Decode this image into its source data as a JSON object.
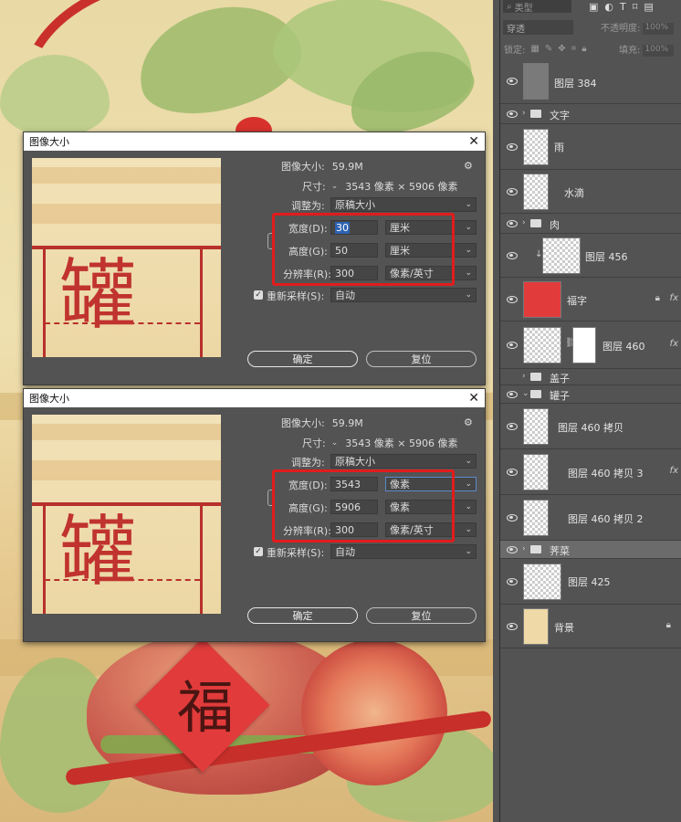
{
  "dialog_title": "图像大小",
  "dialogs": [
    {
      "title": "图像大小",
      "image_size_label": "图像大小:",
      "image_size_value": "59.9M",
      "dimensions_label": "尺寸:",
      "dimensions_value": "3543 像素 × 5906 像素",
      "fit_label": "调整为:",
      "fit_value": "原稿大小",
      "width_label": "宽度(D):",
      "width_value": "30",
      "width_unit": "厘米",
      "height_label": "高度(G):",
      "height_value": "50",
      "height_unit": "厘米",
      "resolution_label": "分辨率(R):",
      "resolution_value": "300",
      "resolution_unit": "像素/英寸",
      "resample_label": "重新采样(S):",
      "resample_value": "自动",
      "ok_label": "确定",
      "reset_label": "复位"
    },
    {
      "title": "图像大小",
      "image_size_label": "图像大小:",
      "image_size_value": "59.9M",
      "dimensions_label": "尺寸:",
      "dimensions_value": "3543 像素 × 5906 像素",
      "fit_label": "调整为:",
      "fit_value": "原稿大小",
      "width_label": "宽度(D):",
      "width_value": "3543",
      "width_unit": "像素",
      "height_label": "高度(G):",
      "height_value": "5906",
      "height_unit": "像素",
      "resolution_label": "分辨率(R):",
      "resolution_value": "300",
      "resolution_unit": "像素/英寸",
      "resample_label": "重新采样(S):",
      "resample_value": "自动",
      "ok_label": "确定",
      "reset_label": "复位"
    }
  ],
  "canvas": {
    "fu_character": "福",
    "preview_characters": "罐"
  },
  "layers_panel": {
    "filter_placeholder": "类型",
    "blend_mode": "穿透",
    "opacity_label": "不透明度:",
    "opacity_value": "100%",
    "lock_label": "锁定:",
    "fill_label": "填充:",
    "fill_value": "100%",
    "layers": [
      {
        "name": "图层 384",
        "kind": "layer"
      },
      {
        "name": "文字",
        "kind": "group"
      },
      {
        "name": "雨",
        "kind": "layer"
      },
      {
        "name": "水滴",
        "kind": "layer"
      },
      {
        "name": "肉",
        "kind": "group"
      },
      {
        "name": "图层 456",
        "kind": "layer"
      },
      {
        "name": "福字",
        "kind": "layer"
      },
      {
        "name": "图层 460",
        "kind": "layer"
      },
      {
        "name": "盖子",
        "kind": "group"
      },
      {
        "name": "罐子",
        "kind": "group"
      },
      {
        "name": "图层 460 拷贝",
        "kind": "layer"
      },
      {
        "name": "图层 460 拷贝 3",
        "kind": "layer"
      },
      {
        "name": "图层 460 拷贝 2",
        "kind": "layer"
      },
      {
        "name": "荠菜",
        "kind": "group"
      },
      {
        "name": "图层 425",
        "kind": "layer"
      },
      {
        "name": "背景",
        "kind": "layer"
      }
    ]
  },
  "colors": {
    "accent_red": "#e21c1c",
    "panel_bg": "#535353",
    "selection_blue": "#2e62b3"
  }
}
